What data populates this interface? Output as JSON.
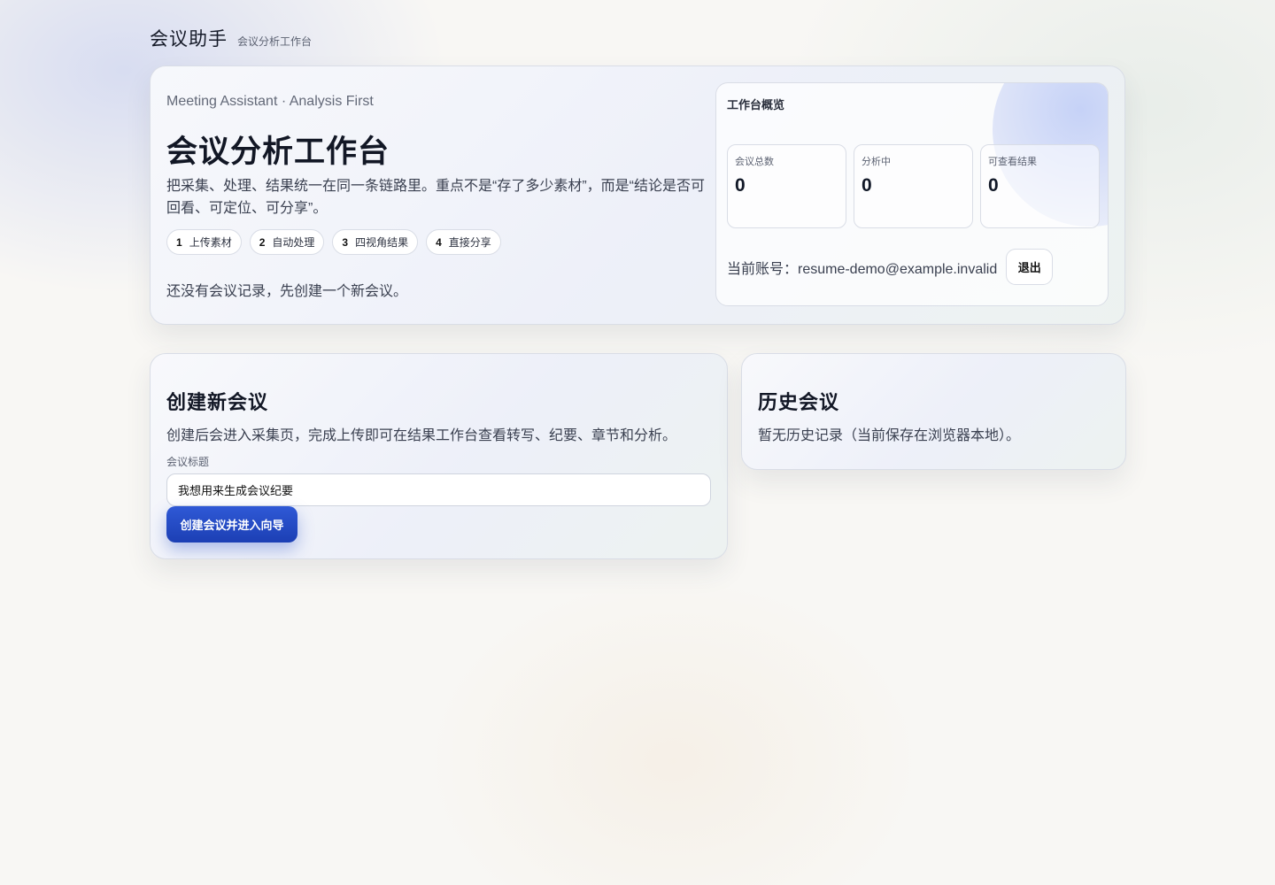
{
  "app": {
    "title": "会议助手",
    "subtitle": "会议分析工作台"
  },
  "hero": {
    "eyebrow": "Meeting Assistant · Analysis First",
    "title": "会议分析工作台",
    "description": "把采集、处理、结果统一在同一条链路里。重点不是“存了多少素材”，而是“结论是否可回看、可定位、可分享”。",
    "steps": [
      {
        "num": "1",
        "label": "上传素材"
      },
      {
        "num": "2",
        "label": "自动处理"
      },
      {
        "num": "3",
        "label": "四视角结果"
      },
      {
        "num": "4",
        "label": "直接分享"
      }
    ],
    "empty_note": "还没有会议记录，先创建一个新会议。"
  },
  "overview": {
    "title": "工作台概览",
    "stats": [
      {
        "label": "会议总数",
        "value": "0"
      },
      {
        "label": "分析中",
        "value": "0"
      },
      {
        "label": "可查看结果",
        "value": "0"
      }
    ],
    "account_text": "当前账号：resume-demo@example.invalid",
    "logout_label": "退出"
  },
  "create": {
    "title": "创建新会议",
    "description": "创建后会进入采集页，完成上传即可在结果工作台查看转写、纪要、章节和分析。",
    "field_label": "会议标题",
    "input_value": "我想用来生成会议纪要",
    "submit_label": "创建会议并进入向导"
  },
  "history": {
    "title": "历史会议",
    "empty_text": "暂无历史记录（当前保存在浏览器本地）。"
  },
  "colors": {
    "accent": "#2448c8",
    "background": "#f8f7f4"
  }
}
